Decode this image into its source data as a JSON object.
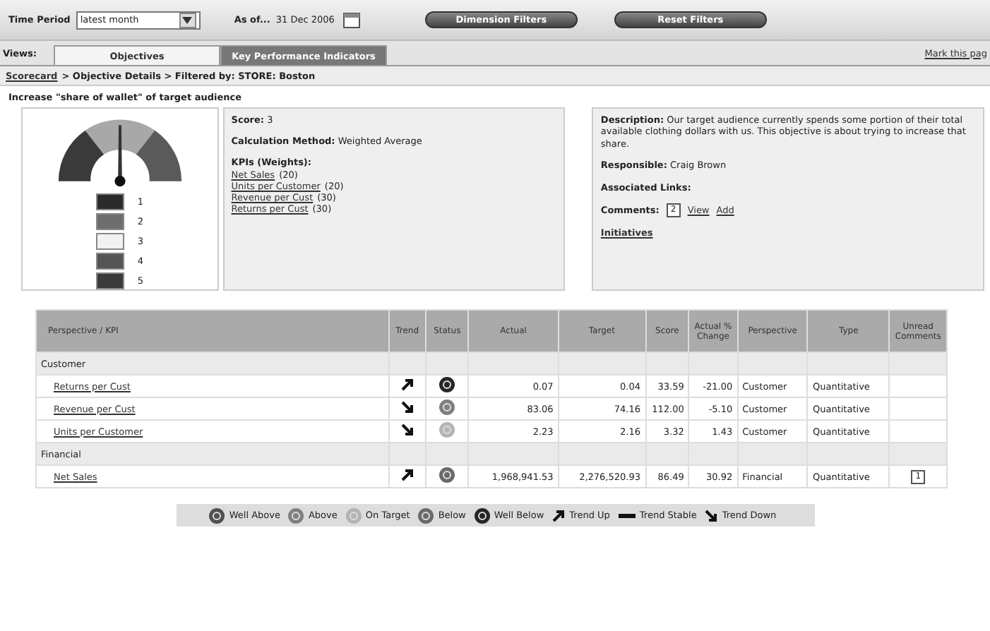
{
  "toolbar": {
    "time_period_label": "Time Period",
    "time_period": "latest month",
    "as_of_label": "As of...",
    "as_of_date": "31 Dec 2006",
    "buttons": [
      "Dimension Filters",
      "Reset Filters"
    ]
  },
  "views": {
    "label": "Views:",
    "tabs": [
      {
        "label": "Objectives",
        "selected": true
      },
      {
        "label": "Key Performance Indicators",
        "selected": false
      }
    ],
    "mark_link": "Mark this pag"
  },
  "breadcrumb": {
    "link": "Scorecard",
    "rest": "> Objective Details > Filtered by: STORE: Boston"
  },
  "objective_title": "Increase \"share of wallet\" of target audience",
  "gauge_legend": [
    {
      "label": "1",
      "color": "#2a2a2a"
    },
    {
      "label": "2",
      "color": "#6e6e6e"
    },
    {
      "label": "3",
      "color": "#f2f2f2"
    },
    {
      "label": "4",
      "color": "#555555"
    },
    {
      "label": "5",
      "color": "#3a3a3a"
    }
  ],
  "details": {
    "score_label": "Score:",
    "score": "3",
    "method_label": "Calculation Method:",
    "method": "Weighted Average",
    "kpis_label": "KPIs (Weights):",
    "kpis": [
      {
        "name": "Net Sales",
        "weight": "(20)"
      },
      {
        "name": "Units per Customer",
        "weight": "(20)"
      },
      {
        "name": "Revenue per Cust",
        "weight": "(30)"
      },
      {
        "name": "Returns per Cust",
        "weight": "(30)"
      }
    ]
  },
  "info": {
    "description_label": "Description:",
    "description": "Our target audience currently spends some portion of their total available clothing dollars with us. This objective is about trying to increase that share.",
    "responsible_label": "Responsible:",
    "responsible": "Craig Brown",
    "links_label": "Associated Links:",
    "comments_label": "Comments:",
    "comments_count": "2",
    "comment_actions": [
      "View",
      "Add"
    ],
    "initiatives": "Initiatives"
  },
  "table": {
    "columns": [
      "Perspective / KPI",
      "Trend",
      "Status",
      "Actual",
      "Target",
      "Score",
      "Actual % Change",
      "Perspective",
      "Type",
      "Unread Comments"
    ],
    "rows": [
      {
        "kind": "group",
        "name": "Customer"
      },
      {
        "kind": "kpi",
        "name": "Returns per Cust",
        "trend": {
          "kind": "up"
        },
        "status": {
          "color": "#262626"
        },
        "actual": "0.07",
        "target": "0.04",
        "score": "33.59",
        "change": "-21.00",
        "perspective": "Customer",
        "type": "Quantitative"
      },
      {
        "kind": "kpi",
        "name": "Revenue per Cust",
        "trend": {
          "kind": "down"
        },
        "status": {
          "color": "#808080"
        },
        "actual": "83.06",
        "target": "74.16",
        "score": "112.00",
        "change": "-5.10",
        "perspective": "Customer",
        "type": "Quantitative"
      },
      {
        "kind": "kpi",
        "name": "Units per Customer",
        "trend": {
          "kind": "down"
        },
        "status": {
          "color": "#b4b4b4"
        },
        "actual": "2.23",
        "target": "2.16",
        "score": "3.32",
        "change": "1.43",
        "perspective": "Customer",
        "type": "Quantitative"
      },
      {
        "kind": "group",
        "name": "Financial"
      },
      {
        "kind": "kpi",
        "name": "Net Sales",
        "trend": {
          "kind": "up"
        },
        "status": {
          "color": "#6a6a6a"
        },
        "actual": "1,968,941.53",
        "target": "2,276,520.93",
        "score": "86.49",
        "change": "30.92",
        "perspective": "Financial",
        "type": "Quantitative",
        "unread": "1"
      }
    ]
  },
  "legend": [
    {
      "kind": "status",
      "label": "Well Above",
      "color": "#505050"
    },
    {
      "kind": "status",
      "label": "Above",
      "color": "#808080"
    },
    {
      "kind": "status",
      "label": "On Target",
      "color": "#b4b4b4"
    },
    {
      "kind": "status",
      "label": "Below",
      "color": "#6a6a6a"
    },
    {
      "kind": "status",
      "label": "Well Below",
      "color": "#262626"
    },
    {
      "kind": "trend_up",
      "label": "Trend Up"
    },
    {
      "kind": "trend_stable",
      "label": "Trend Stable"
    },
    {
      "kind": "trend_down",
      "label": "Trend Down"
    }
  ]
}
